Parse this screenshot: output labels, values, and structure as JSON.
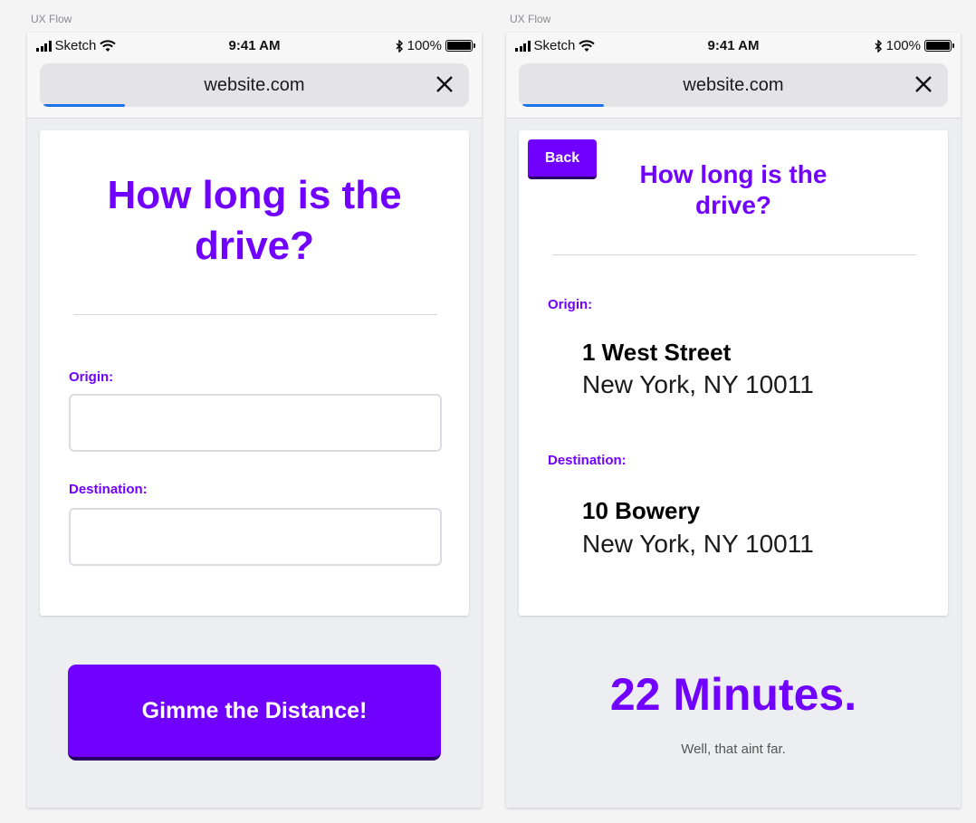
{
  "screens": [
    {
      "label": "UX Flow",
      "status": {
        "carrier": "Sketch",
        "time": "9:41 AM",
        "battery": "100%"
      },
      "url": "website.com",
      "title": "How long is the drive?",
      "origin_label": "Origin:",
      "origin_value": "",
      "destination_label": "Destination:",
      "destination_value": "",
      "cta_label": "Gimme the Distance!"
    },
    {
      "label": "UX Flow",
      "status": {
        "carrier": "Sketch",
        "time": "9:41 AM",
        "battery": "100%"
      },
      "url": "website.com",
      "back_label": "Back",
      "title": "How long is the drive?",
      "origin_label": "Origin:",
      "origin_street": "1 West Street",
      "origin_city": "New York, NY 10011",
      "destination_label": "Destination:",
      "destination_street": "10 Bowery",
      "destination_city": "New York, NY 10011",
      "result_main": "22 Minutes.",
      "result_sub": "Well, that aint far."
    }
  ],
  "colors": {
    "accent": "#7000ff",
    "progress": "#1a73e8"
  },
  "icons": [
    "signal-icon",
    "wifi-icon",
    "bluetooth-icon",
    "battery-icon",
    "close-icon"
  ]
}
